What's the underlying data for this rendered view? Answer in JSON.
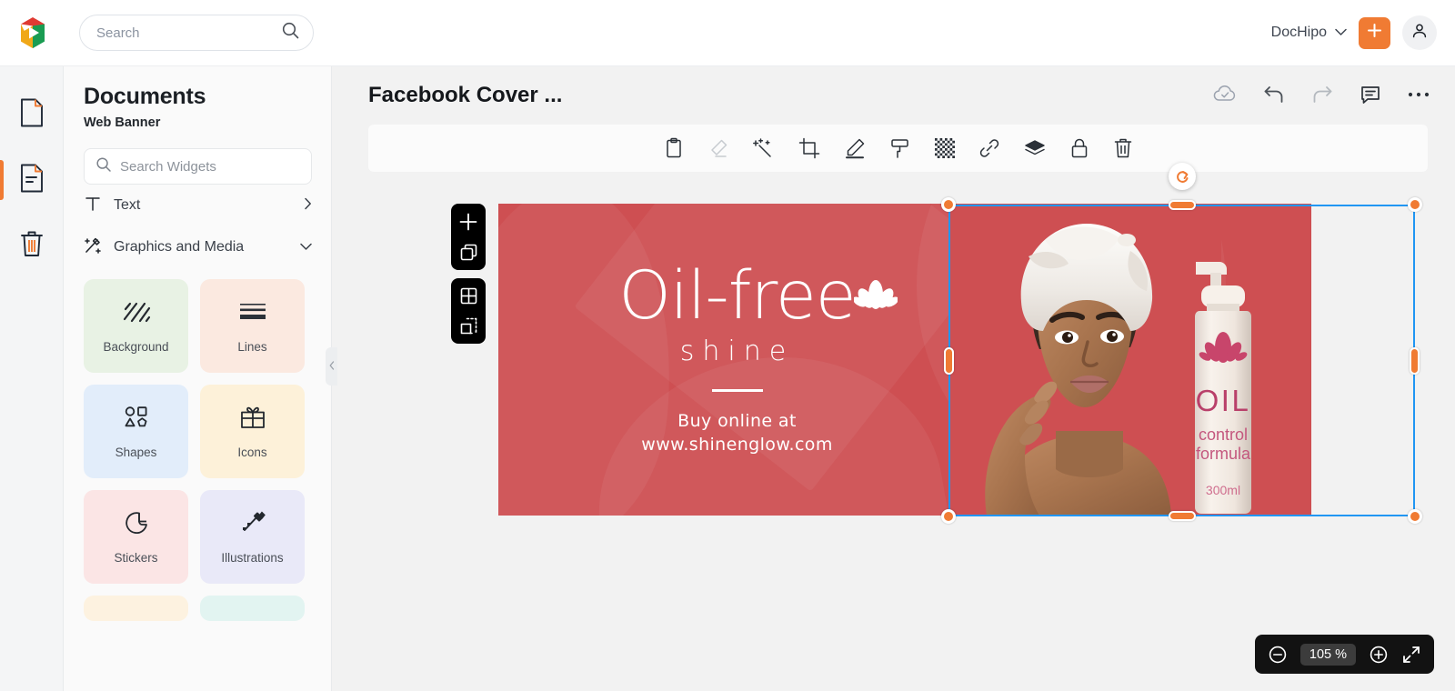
{
  "header": {
    "logo_name": "dochipo-logo",
    "search": {
      "placeholder": "Search",
      "value": ""
    },
    "workspace": "DocHipo",
    "add_label": "+",
    "icons": {
      "search": "search-icon",
      "chevron": "chevron-down-icon",
      "plus": "plus-icon",
      "avatar": "user-avatar-icon"
    }
  },
  "rail": {
    "items": [
      {
        "name": "page-icon",
        "label": "Pages",
        "active": false
      },
      {
        "name": "document-icon",
        "label": "Documents",
        "active": true
      },
      {
        "name": "trash-icon",
        "label": "Trash",
        "active": false
      }
    ]
  },
  "panel": {
    "title": "Documents",
    "subtitle": "Web Banner",
    "search": {
      "placeholder": "Search Widgets",
      "value": ""
    },
    "categories": [
      {
        "label": "Text",
        "icon": "text-t-icon",
        "chevron": "chevron-right-icon",
        "expanded": false
      },
      {
        "label": "Graphics and Media",
        "icon": "graphics-media-icon",
        "chevron": "chevron-down-icon",
        "expanded": true
      }
    ],
    "cards": [
      {
        "label": "Background",
        "icon": "diagonal-stripes-icon",
        "bg": "#e8f2e4"
      },
      {
        "label": "Lines",
        "icon": "horizontal-lines-icon",
        "bg": "#fbe9e0"
      },
      {
        "label": "Shapes",
        "icon": "shapes-icon",
        "bg": "#e2edfa"
      },
      {
        "label": "Icons",
        "icon": "gift-box-icon",
        "bg": "#fdf1d9"
      },
      {
        "label": "Stickers",
        "icon": "sticker-icon",
        "bg": "#fbe5e5"
      },
      {
        "label": "Illustrations",
        "icon": "pencil-brush-icon",
        "bg": "#e9e9f8"
      }
    ],
    "partial_cards": [
      {
        "bg": "#fdf2e0"
      },
      {
        "bg": "#e2f4f1"
      }
    ],
    "collapse_icon": "chevron-left-icon"
  },
  "canvas": {
    "document_title": "Facebook Cover ...",
    "top_actions": [
      {
        "name": "cloud-saved-icon",
        "label": "Saved"
      },
      {
        "name": "undo-icon",
        "label": "Undo"
      },
      {
        "name": "redo-icon",
        "label": "Redo"
      },
      {
        "name": "comment-icon",
        "label": "Comments"
      },
      {
        "name": "more-options-icon",
        "label": "More"
      }
    ],
    "object_toolbar": [
      {
        "name": "clipboard-icon",
        "label": "Paste"
      },
      {
        "name": "eraser-icon",
        "label": "Erase"
      },
      {
        "name": "magic-wand-icon",
        "label": "Magic"
      },
      {
        "name": "crop-icon",
        "label": "Crop"
      },
      {
        "name": "pencil-edit-icon",
        "label": "Edit"
      },
      {
        "name": "paint-roller-icon",
        "label": "Fill"
      },
      {
        "name": "transparency-icon",
        "label": "Transparency"
      },
      {
        "name": "link-icon",
        "label": "Link"
      },
      {
        "name": "layers-icon",
        "label": "Layers"
      },
      {
        "name": "lock-icon",
        "label": "Lock"
      },
      {
        "name": "delete-icon",
        "label": "Delete"
      }
    ],
    "float_tools": [
      {
        "name": "add-page-icon",
        "label": "Add Page"
      },
      {
        "name": "duplicate-page-icon",
        "label": "Duplicate Page"
      },
      {
        "name": "grid-view-icon",
        "label": "Grid"
      },
      {
        "name": "select-area-icon",
        "label": "Select Area"
      }
    ],
    "zoom": {
      "value": "105 %",
      "minus_icon": "zoom-out-icon",
      "plus_icon": "zoom-in-icon",
      "fullscreen_icon": "fullscreen-icon"
    },
    "selection": {
      "rotate_icon": "rotate-handle-icon",
      "handles": [
        "top-left",
        "top-center",
        "top-right",
        "middle-left",
        "middle-right",
        "bottom-left",
        "bottom-center",
        "bottom-right"
      ]
    }
  },
  "banner": {
    "bg_color": "#ce4f52",
    "headline": "Oil-free",
    "subhead": "shine",
    "lotus_icon": "lotus-flower-icon",
    "buy_line_1": "Buy online at",
    "buy_line_2": "www.shinenglow.com",
    "model_alt": "woman-with-towel-photo",
    "product": {
      "name": "OIL",
      "line1": "control",
      "line2": "formula",
      "volume": "300ml",
      "logo": "lotus-flower-icon",
      "accent": "#c8456b"
    }
  }
}
